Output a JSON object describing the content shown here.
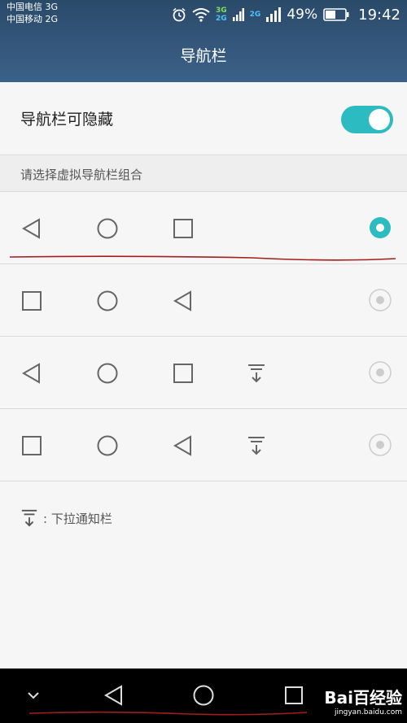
{
  "status_bar": {
    "carrier_1": "中国电信 3G",
    "carrier_2": "中国移动 2G",
    "net_tag_3g": "3G",
    "net_tag_2g": "2G",
    "net_tag_2g_b": "2G",
    "battery": "49%",
    "time": "19:42",
    "icons": [
      "alarm-icon",
      "wifi-icon",
      "signal-icon",
      "signal-icon",
      "battery-icon"
    ]
  },
  "header": {
    "title": "导航栏"
  },
  "settings": {
    "toggle_label": "导航栏可隐藏",
    "toggle_on": true,
    "section_label": "请选择虚拟导航栏组合",
    "combos": [
      {
        "keys": [
          "back-icon",
          "home-icon",
          "recent-icon"
        ],
        "selected": true
      },
      {
        "keys": [
          "recent-icon",
          "home-icon",
          "back-icon"
        ],
        "selected": false
      },
      {
        "keys": [
          "back-icon",
          "home-icon",
          "recent-icon",
          "notification-pulldown-icon"
        ],
        "selected": false
      },
      {
        "keys": [
          "recent-icon",
          "home-icon",
          "back-icon",
          "notification-pulldown-icon"
        ],
        "selected": false
      }
    ],
    "hint_text": ": 下拉通知栏"
  },
  "nav_bar": {
    "keys": [
      "hide-nav-icon",
      "back-icon",
      "home-icon",
      "recent-icon"
    ]
  },
  "watermark": {
    "brand": "Bai百经验",
    "url": "jingyan.baidu.com"
  },
  "colors": {
    "header": "#34577b",
    "accent": "#2dbbc2",
    "annotation": "#a31d1d"
  }
}
